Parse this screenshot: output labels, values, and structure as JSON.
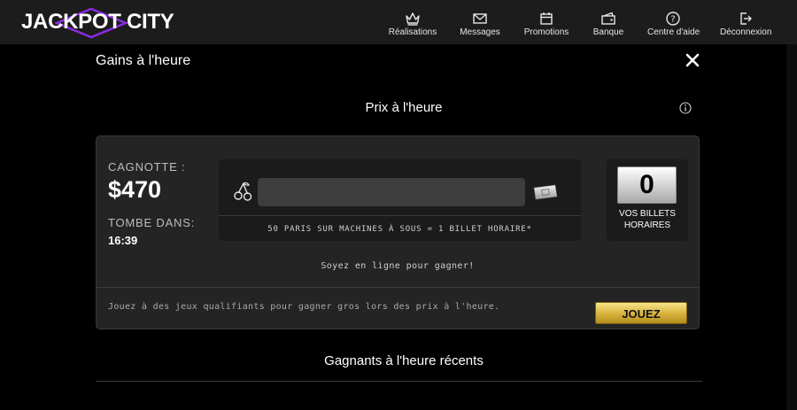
{
  "header": {
    "brand": "JACKPOT CITY",
    "nav": [
      {
        "label": "Réalisations",
        "icon": "crown-icon"
      },
      {
        "label": "Messages",
        "icon": "envelope-icon"
      },
      {
        "label": "Promotions",
        "icon": "calendar-icon"
      },
      {
        "label": "Banque",
        "icon": "wallet-icon"
      },
      {
        "label": "Centre d'aide",
        "icon": "help-icon"
      },
      {
        "label": "Déconnexion",
        "icon": "logout-icon"
      }
    ]
  },
  "page": {
    "title": "Gains à l'heure",
    "subtitle": "Prix à l'heure",
    "recent_title": "Gagnants à l'heure récents"
  },
  "jackpot": {
    "pot_label": "CAGNOTTE :",
    "pot_value": "$470",
    "falls_label": "TOMBE DANS:",
    "falls_value": "16:39",
    "progress_fraction": 0,
    "progress_note": "50 PARIS SUR MACHINES À SOUS = 1 BILLET HORAIRE*",
    "tickets_count": "0",
    "tickets_label": "VOS BILLETS HORAIRES",
    "online_note": "Soyez en ligne pour gagner!",
    "qualify_note": "Jouez à des jeux qualifiants pour gagner gros lors des prix à l'heure.",
    "play_label": "JOUEZ"
  },
  "colors": {
    "accent_purple": "#7b2fbf",
    "play_gold": "#d7b13b",
    "card_bg": "#242424",
    "topbar_bg": "#1c1c1c"
  }
}
